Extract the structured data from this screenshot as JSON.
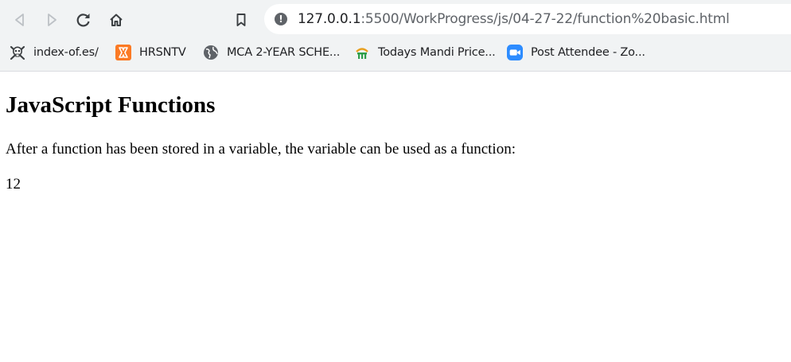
{
  "browser": {
    "address_host": "127.0.0.1",
    "address_path": ":5500/WorkProgress/js/04-27-22/function%20basic.html",
    "bookmarks": [
      {
        "label": "index-of.es/",
        "icon": "skull-crossbones-icon"
      },
      {
        "label": "HRSNTV",
        "icon": "xampp-icon"
      },
      {
        "label": "MCA 2-YEAR SCHE...",
        "icon": "globe-icon"
      },
      {
        "label": "Todays Mandi Price...",
        "icon": "mandi-logo-icon"
      },
      {
        "label": "Post Attendee - Zo...",
        "icon": "zoom-video-icon"
      }
    ]
  },
  "page": {
    "heading": "JavaScript Functions",
    "description": "After a function has been stored in a variable, the variable can be used as a function:",
    "result": "12"
  },
  "colors": {
    "chrome_bg": "#f1f3f4",
    "icon_gray": "#5f6368",
    "xampp_orange": "#fb7a24",
    "zoom_blue": "#2d8cff"
  }
}
